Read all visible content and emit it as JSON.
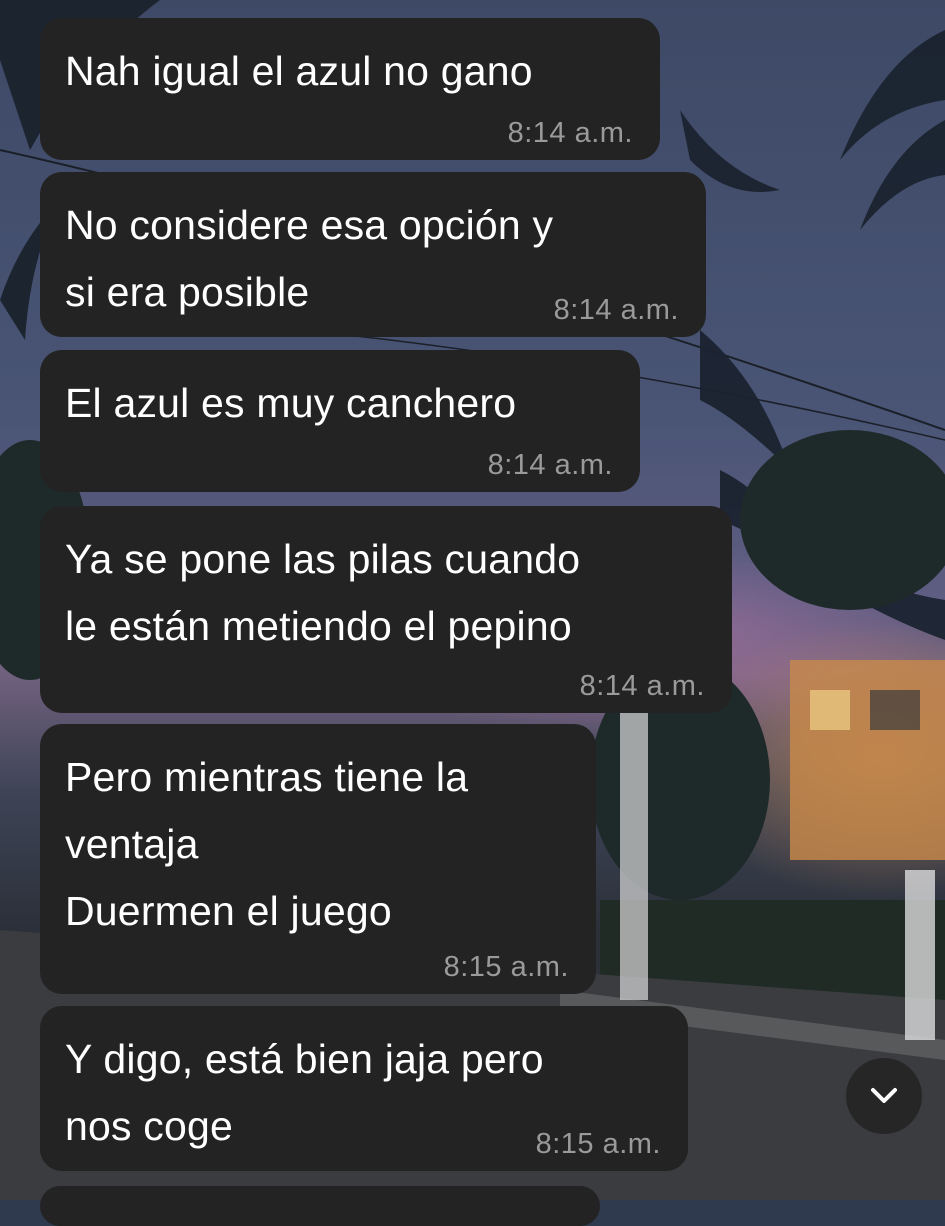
{
  "messages": [
    {
      "text": "Nah igual el azul no gano",
      "time": "8:14 a.m."
    },
    {
      "text": "No considere esa opción y\nsi era posible",
      "time": "8:14 a.m."
    },
    {
      "text": "El azul es muy canchero",
      "time": "8:14 a.m."
    },
    {
      "text": "Ya se pone las pilas cuando\nle están metiendo el pepino",
      "time": "8:14 a.m."
    },
    {
      "text": "Pero mientras tiene la\nventaja\nDuermen el juego",
      "time": "8:15 a.m."
    },
    {
      "text": "Y digo, está bien jaja pero\nnos coge",
      "time": "8:15 a.m."
    }
  ],
  "scroll_button": {
    "icon": "chevron-down-icon"
  }
}
